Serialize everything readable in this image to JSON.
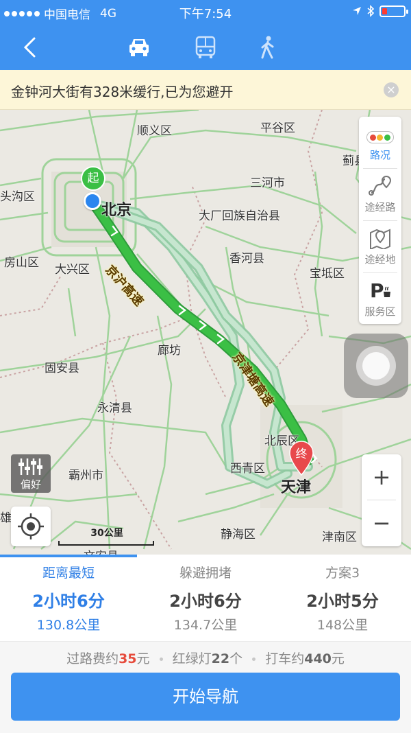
{
  "statusbar": {
    "carrier": "中国电信",
    "network": "4G",
    "time": "下午7:54"
  },
  "nav": {
    "back_icon": "back-chevron-icon",
    "modes": [
      {
        "name": "car",
        "icon": "car-icon",
        "active": true
      },
      {
        "name": "bus",
        "icon": "bus-icon",
        "active": false
      },
      {
        "name": "walk",
        "icon": "walk-icon",
        "active": false
      }
    ]
  },
  "notice": {
    "text": "金钟河大街有328米缓行,已为您避开",
    "close": "×"
  },
  "map": {
    "places": {
      "shunyi": "顺义区",
      "pinggu": "平谷区",
      "ji": "蓟县",
      "toudougou": "头沟区",
      "beijing": "北京",
      "sanhe": "三河市",
      "dachang": "大厂回族自治县",
      "fangshan": "房山区",
      "daxing": "大兴区",
      "xianghe": "香河县",
      "baodi": "宝坻区",
      "langfang": "廊坊",
      "guan": "固安县",
      "yongqing": "永清县",
      "beichen": "北辰区",
      "xiqing": "西青区",
      "tianjin": "天津",
      "bazhou": "霸州市",
      "xiong": "雄",
      "jinghai": "静海区",
      "jinnan": "津南区",
      "wenan": "文安县"
    },
    "road_labels": {
      "jinghu": "京沪高速",
      "jingjin": "京津塘高速"
    },
    "start_marker": "起",
    "end_marker": "终",
    "side_panel": [
      {
        "label": "路况",
        "icon": "traffic-light-icon",
        "active": true
      },
      {
        "label": "途经路",
        "icon": "route-via-icon",
        "active": false
      },
      {
        "label": "途经地",
        "icon": "map-pin-icon",
        "active": false
      },
      {
        "label": "服务区",
        "icon": "parking-service-icon",
        "active": false
      }
    ],
    "prefer_label": "偏好",
    "scale_label": "30公里",
    "zoom_in": "+",
    "zoom_out": "−"
  },
  "routes": [
    {
      "name": "距离最短",
      "time": "2小时6分",
      "distance": "130.8公里",
      "active": true
    },
    {
      "name": "躲避拥堵",
      "time": "2小时6分",
      "distance": "134.7公里",
      "active": false
    },
    {
      "name": "方案3",
      "time": "2小时5分",
      "distance": "148公里",
      "active": false
    }
  ],
  "summary": {
    "toll_prefix": "过路费约",
    "toll_value": "35",
    "toll_unit": "元",
    "lights_prefix": "红绿灯",
    "lights_value": "22",
    "lights_unit": "个",
    "taxi_prefix": "打车约",
    "taxi_value": "440",
    "taxi_unit": "元"
  },
  "start_button": "开始导航",
  "colors": {
    "brand_blue": "#3e92f0",
    "route_green": "#3bbf45",
    "alt_route": "#b9dcc0",
    "start_marker": "#3bbf45",
    "end_marker": "#e8494c"
  }
}
